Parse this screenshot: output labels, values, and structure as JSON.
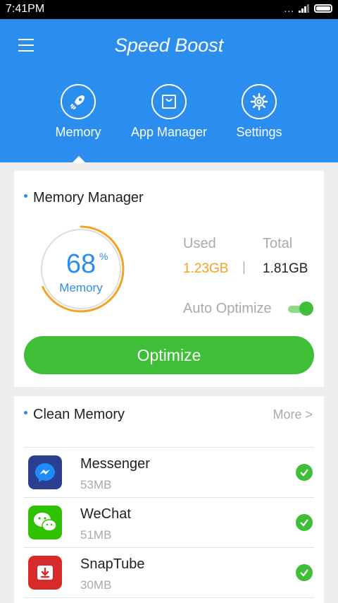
{
  "status_bar": {
    "time": "7:41PM",
    "dots": "..."
  },
  "header": {
    "title": "Speed Boost"
  },
  "tabs": [
    {
      "label": "Memory",
      "icon": "rocket-icon",
      "active": true
    },
    {
      "label": "App Manager",
      "icon": "bag-icon",
      "active": false
    },
    {
      "label": "Settings",
      "icon": "gear-icon",
      "active": false
    }
  ],
  "memory_manager": {
    "title": "Memory Manager",
    "percent": "68",
    "percent_value": 68,
    "percent_sign": "%",
    "gauge_label": "Memory",
    "used_label": "Used",
    "used_value": "1.23GB",
    "total_label": "Total",
    "total_value": "1.81GB",
    "auto_optimize_label": "Auto Optimize",
    "auto_optimize_on": true,
    "optimize_button": "Optimize"
  },
  "clean_memory": {
    "title": "Clean Memory",
    "more_label": "More >",
    "apps": [
      {
        "name": "Messenger",
        "size": "53MB",
        "icon": "messenger-icon",
        "checked": true
      },
      {
        "name": "WeChat",
        "size": "51MB",
        "icon": "wechat-icon",
        "checked": true
      },
      {
        "name": "SnapTube",
        "size": "30MB",
        "icon": "snaptube-icon",
        "checked": true
      }
    ]
  },
  "colors": {
    "header_blue": "#2b8eef",
    "accent_green": "#3fbf38",
    "used_orange": "#f3a31f",
    "gauge_track": "#dddddd"
  }
}
